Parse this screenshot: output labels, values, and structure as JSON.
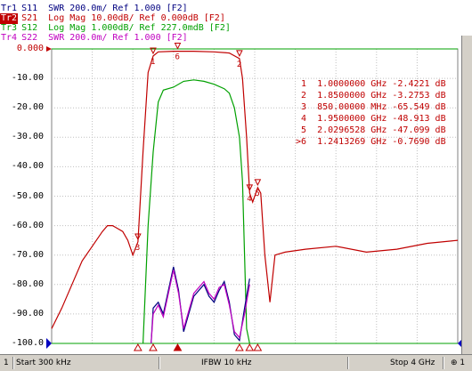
{
  "traces": [
    {
      "tag": "Tr1",
      "text": "S11  SWR 200.0m/ Ref 1.000 [F2]",
      "color": "#000080",
      "active": false
    },
    {
      "tag": "Tr2",
      "text": "S21  Log Mag 10.00dB/ Ref 0.000dB [F2]",
      "color": "#c00000",
      "active": true
    },
    {
      "tag": "Tr3",
      "text": "S12  Log Mag 1.000dB/ Ref 227.0mdB [F2]",
      "color": "#00a000",
      "active": false
    },
    {
      "tag": "Tr4",
      "text": "S22  SWR 200.0m/ Ref 1.000 [F2]",
      "color": "#c000c0",
      "active": false
    }
  ],
  "y_axis_labels": [
    "0.000",
    "-10.00",
    "-20.00",
    "-30.00",
    "-40.00",
    "-50.00",
    "-60.00",
    "-70.00",
    "-80.00",
    "-90.00",
    "-100.0"
  ],
  "marker_table": [
    {
      "id": "1",
      "freq": "1.0000000 GHz",
      "value": "-2.4221 dB"
    },
    {
      "id": "2",
      "freq": "1.8500000 GHz",
      "value": "-3.2753 dB"
    },
    {
      "id": "3",
      "freq": "850.00000 MHz",
      "value": "-65.549 dB"
    },
    {
      "id": "4",
      "freq": "1.9500000 GHz",
      "value": "-48.913 dB"
    },
    {
      "id": "5",
      "freq": "2.0296528 GHz",
      "value": "-47.099 dB"
    },
    {
      "id": ">6",
      "freq": "1.2413269 GHz",
      "value": "-0.7690 dB"
    }
  ],
  "status_bar": {
    "channel": "1",
    "start": "Start 300 kHz",
    "ifbw": "IFBW 10 kHz",
    "stop": "Stop 4 GHz",
    "right": "⊕ 1"
  },
  "chart_data": {
    "type": "line",
    "x_range_ghz": [
      0.0003,
      4.0
    ],
    "ylim": [
      -100,
      0
    ],
    "grid": true,
    "series": [
      {
        "name": "S21",
        "color": "#c00000",
        "x": [
          0.0003,
          0.1,
          0.2,
          0.3,
          0.4,
          0.5,
          0.55,
          0.6,
          0.65,
          0.7,
          0.75,
          0.8,
          0.85,
          0.9,
          0.95,
          1.0,
          1.05,
          1.2,
          1.4,
          1.6,
          1.75,
          1.85,
          1.88,
          1.92,
          1.95,
          1.98,
          2.03,
          2.06,
          2.1,
          2.15,
          2.2,
          2.3,
          2.5,
          2.8,
          3.1,
          3.4,
          3.7,
          4.0
        ],
        "y": [
          -95,
          -88,
          -80,
          -72,
          -67,
          -62,
          -60,
          -60,
          -61,
          -62,
          -65,
          -70,
          -65.5,
          -35,
          -8,
          -2.4,
          -1.0,
          -0.8,
          -0.8,
          -1.0,
          -1.4,
          -3.3,
          -10,
          -30,
          -48.9,
          -52,
          -47.1,
          -49,
          -70,
          -86,
          -70,
          -69,
          -68,
          -67,
          -69,
          -68,
          -66,
          -65
        ]
      },
      {
        "name": "S12",
        "color": "#00a000",
        "x": [
          0.9,
          0.95,
          1.0,
          1.05,
          1.1,
          1.2,
          1.3,
          1.4,
          1.5,
          1.6,
          1.7,
          1.75,
          1.8,
          1.85,
          1.88,
          1.9,
          1.92,
          1.95
        ],
        "y": [
          -100,
          -60,
          -35,
          -18,
          -14,
          -13,
          -11,
          -10.5,
          -11,
          -12,
          -13.5,
          -15,
          -20,
          -30,
          -45,
          -70,
          -95,
          -100
        ]
      },
      {
        "name": "S11",
        "color": "#000080",
        "x": [
          0.98,
          1.0,
          1.05,
          1.1,
          1.2,
          1.25,
          1.3,
          1.4,
          1.5,
          1.55,
          1.6,
          1.65,
          1.7,
          1.75,
          1.8,
          1.85,
          1.9,
          1.95
        ],
        "y": [
          -100,
          -88,
          -86,
          -90,
          -74,
          -82,
          -96,
          -84,
          -80,
          -84,
          -86,
          -82,
          -79,
          -86,
          -97,
          -99,
          -88,
          -78
        ]
      },
      {
        "name": "S22",
        "color": "#c000c0",
        "x": [
          0.98,
          1.0,
          1.05,
          1.1,
          1.2,
          1.25,
          1.3,
          1.4,
          1.5,
          1.55,
          1.6,
          1.65,
          1.7,
          1.75,
          1.8,
          1.85,
          1.9,
          1.95
        ],
        "y": [
          -100,
          -90,
          -87,
          -91,
          -75,
          -83,
          -95,
          -83,
          -79,
          -83,
          -85,
          -81,
          -80,
          -87,
          -96,
          -98,
          -90,
          -80
        ]
      }
    ]
  }
}
